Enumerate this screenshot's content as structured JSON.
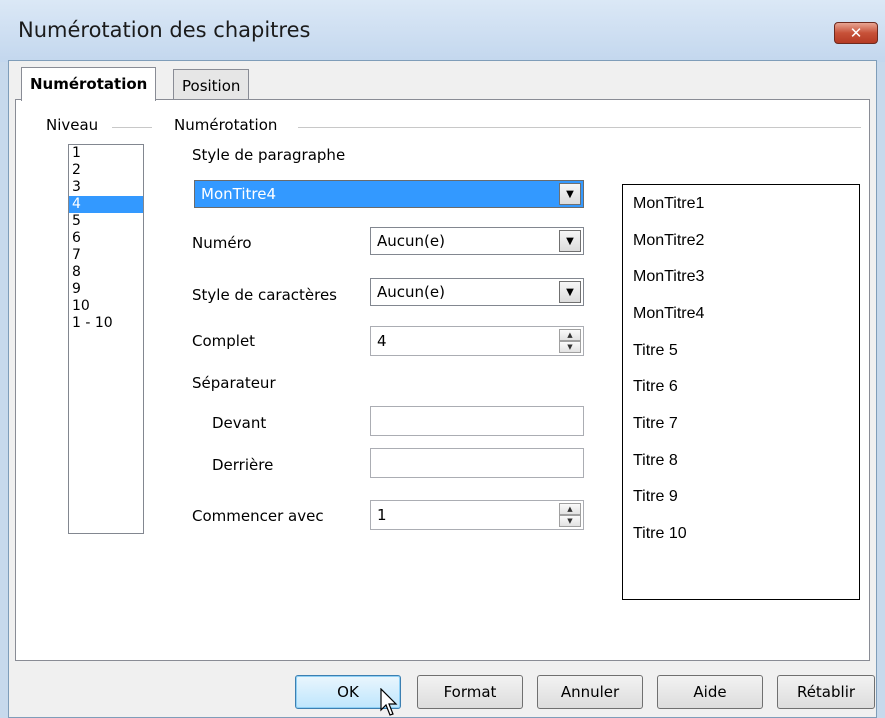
{
  "window": {
    "title": "Numérotation des chapitres",
    "close_glyph": "✕"
  },
  "tabs": [
    {
      "label": "Numérotation",
      "active": true
    },
    {
      "label": "Position",
      "active": false
    }
  ],
  "levels": {
    "group_label": "Niveau",
    "items": [
      "1",
      "2",
      "3",
      "4",
      "5",
      "6",
      "7",
      "8",
      "9",
      "10",
      "1 - 10"
    ],
    "selected": "4"
  },
  "numbering": {
    "group_label": "Numérotation",
    "paragraph_style_label": "Style de paragraphe",
    "paragraph_style_value": "MonTitre4",
    "number_label": "Numéro",
    "number_value": "Aucun(e)",
    "char_style_label": "Style de caractères",
    "char_style_value": "Aucun(e)",
    "complete_label": "Complet",
    "complete_value": "4",
    "separator_label": "Séparateur",
    "before_label": "Devant",
    "before_value": "",
    "after_label": "Derrière",
    "after_value": "",
    "start_label": "Commencer avec",
    "start_value": "1"
  },
  "preview": {
    "items": [
      "MonTitre1",
      "MonTitre2",
      "MonTitre3",
      "MonTitre4",
      "Titre 5",
      "Titre 6",
      "Titre 7",
      "Titre 8",
      "Titre 9",
      "Titre 10"
    ]
  },
  "buttons": {
    "ok": "OK",
    "format": "Format",
    "cancel": "Annuler",
    "help": "Aide",
    "reset": "Rétablir"
  },
  "colors": {
    "selection": "#3399ff",
    "close_button": "#c75138"
  }
}
